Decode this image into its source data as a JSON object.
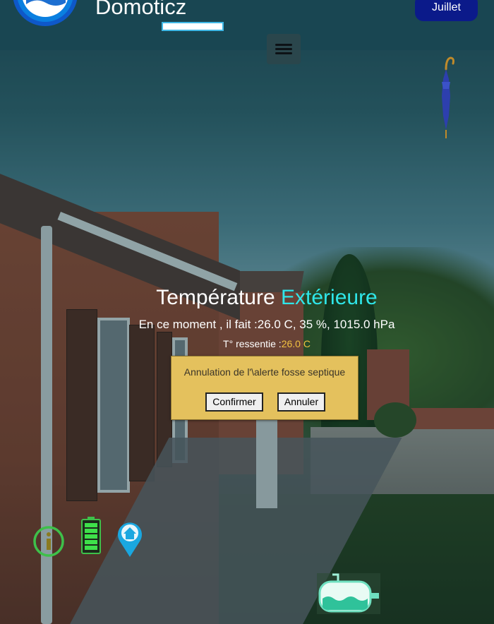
{
  "header": {
    "app_title": "Domoticz",
    "month_button": "Juillet"
  },
  "menu": {
    "icon": "hamburger-menu-icon"
  },
  "weather": {
    "title_main": "Température",
    "title_accent": "Extérieure",
    "current_text": "En ce moment , il fait :26.0 C, 35 %, 1015.0 hPa",
    "feels_label": "T° ressentie :",
    "feels_value": "26.0 C",
    "umbrella_icon": "umbrella-closed-icon"
  },
  "dialog": {
    "message": "Annulation de l'\\alerte fosse septique",
    "confirm_label": "Confirmer",
    "cancel_label": "Annuler"
  },
  "bottom_icons": [
    "info-icon",
    "battery-icon",
    "home-location-pin-icon",
    "septic-tank-icon"
  ],
  "battery": {
    "level": 1.0
  },
  "colors": {
    "header_bg": "#19465a",
    "accent_cyan": "#2fe6e9",
    "feels_value": "#f0c040",
    "dialog_bg": "#e4c15d",
    "month_button_bg": "#0b1a8a",
    "icon_green": "#3ec04a",
    "icon_blue": "#1aa7e0"
  }
}
